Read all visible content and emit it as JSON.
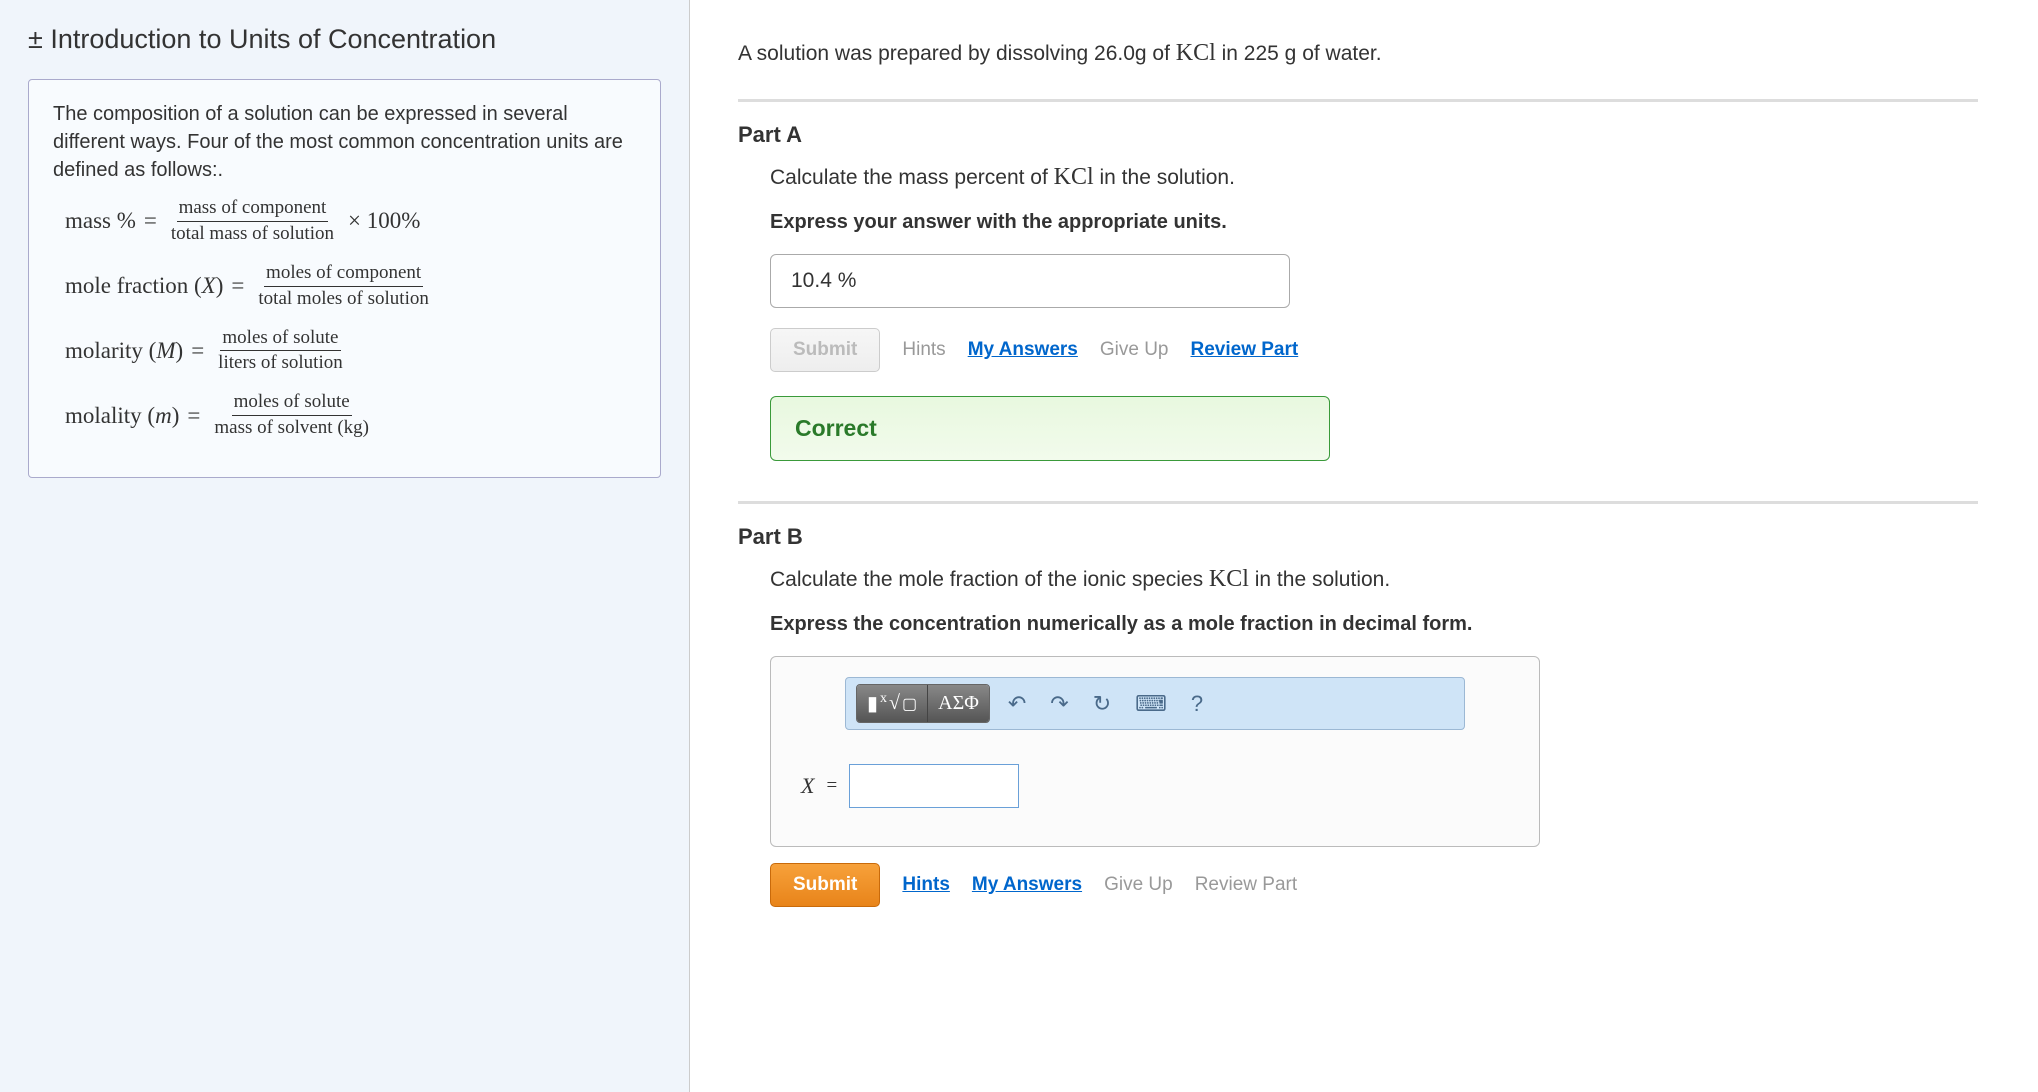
{
  "left": {
    "title_prefix": "±",
    "title": "Introduction to Units of Concentration",
    "intro": "The composition of a solution can be expressed in several different ways. Four of the most common concentration units are defined as follows:.",
    "formulas": {
      "mass_pct_lhs": "mass %",
      "mass_pct_num": "mass of component",
      "mass_pct_den": "total mass of solution",
      "mass_pct_tail": "× 100%",
      "molefrac_lhs": "mole fraction (X)",
      "molefrac_num": "moles of component",
      "molefrac_den": "total moles of solution",
      "molarity_lhs": "molarity (M)",
      "molarity_num": "moles of solute",
      "molarity_den": "liters of solution",
      "molality_lhs": "molality (m)",
      "molality_num": "moles of solute",
      "molality_den": "mass of solvent (kg)"
    }
  },
  "right": {
    "problem_pre": "A solution was prepared by dissolving 26.0g of ",
    "kcl": "KCl",
    "problem_post": " in 225 g of water.",
    "partA": {
      "label": "Part A",
      "question_pre": "Calculate the mass percent of ",
      "question_post": " in the solution.",
      "instruction": "Express your answer with the appropriate units.",
      "answer": "10.4 %",
      "submit": "Submit",
      "hints": "Hints",
      "my_answers": "My Answers",
      "give_up": "Give Up",
      "review": "Review Part",
      "correct": "Correct"
    },
    "partB": {
      "label": "Part B",
      "question_pre": "Calculate the mole fraction of the ionic species ",
      "question_post": " in the solution.",
      "instruction": "Express the concentration numerically as a mole fraction in decimal form.",
      "toolbar": {
        "math": "√",
        "greek": "ΑΣΦ",
        "undo": "↶",
        "redo": "↷",
        "reset": "↻",
        "keyboard": "⌨",
        "help": "?"
      },
      "eq_label": "X",
      "eq_equals": "=",
      "answer": "",
      "submit": "Submit",
      "hints": "Hints",
      "my_answers": "My Answers",
      "give_up": "Give Up",
      "review": "Review Part"
    }
  }
}
